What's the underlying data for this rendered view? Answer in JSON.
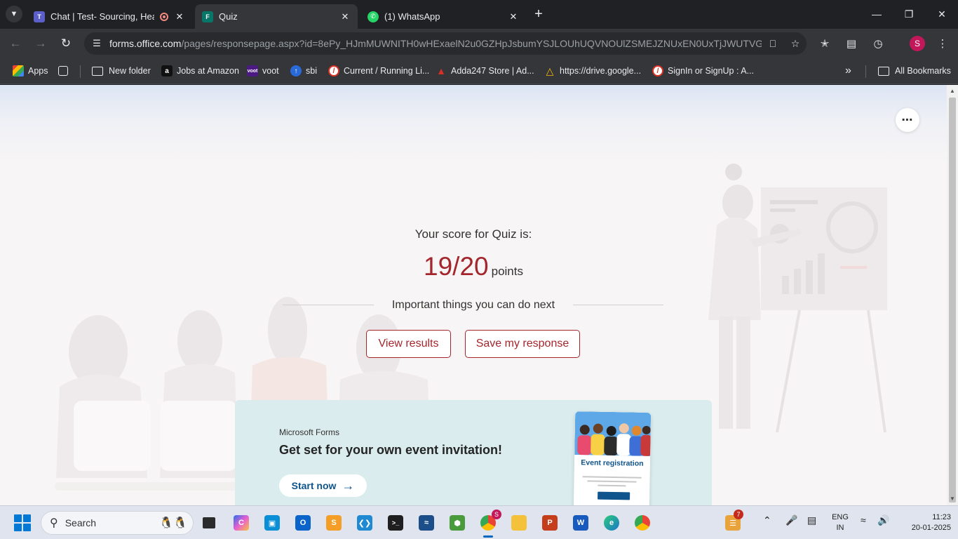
{
  "browser": {
    "tabs": [
      {
        "title": "Chat | Test- Sourcing, Head",
        "active": false
      },
      {
        "title": "Quiz",
        "active": true
      },
      {
        "title": "(1) WhatsApp",
        "active": false
      }
    ],
    "url_host": "forms.office.com",
    "url_path": "/pages/responsepage.aspx?id=8ePy_HJmMUWNITH0wHExaelN2u0GZHpJsbumYSJLOUhUQVNOUlZSMEJZNUxEN0UxTjJWUTVGQ...",
    "profile_initial": "S"
  },
  "bookmarks": {
    "items": [
      {
        "label": "Apps",
        "icon": "apps-grid-icon"
      },
      {
        "label": "New folder",
        "icon": "folder-icon"
      },
      {
        "label": "Jobs at Amazon",
        "icon": "amazon-icon"
      },
      {
        "label": "voot",
        "icon": "voot-icon"
      },
      {
        "label": "sbi",
        "icon": "sbi-icon"
      },
      {
        "label": "Current / Running Li...",
        "icon": "blocked-site-icon"
      },
      {
        "label": "Adda247 Store | Ad...",
        "icon": "adda247-icon"
      },
      {
        "label": "https://drive.google...",
        "icon": "google-drive-icon"
      },
      {
        "label": "SignIn or SignUp : A...",
        "icon": "blocked-site-icon"
      }
    ],
    "all_bookmarks": "All Bookmarks"
  },
  "quiz": {
    "score_label": "Your score for Quiz is:",
    "score": "19/20",
    "unit": "points",
    "next_label": "Important things you can do next",
    "view_results": "View results",
    "save_response": "Save my response"
  },
  "promo": {
    "brand": "Microsoft Forms",
    "title": "Get set for your own event invitation!",
    "cta": "Start now",
    "card_title": "Event registration"
  },
  "taskbar": {
    "search_placeholder": "Search",
    "chrome_badge": "S",
    "widget_badge": "7",
    "lang_line1": "ENG",
    "lang_line2": "IN",
    "time": "11:23",
    "date": "20-01-2025"
  },
  "colors": {
    "accent": "#a4262c",
    "promo_bg": "#daeced",
    "promo_link": "#0f548c"
  }
}
